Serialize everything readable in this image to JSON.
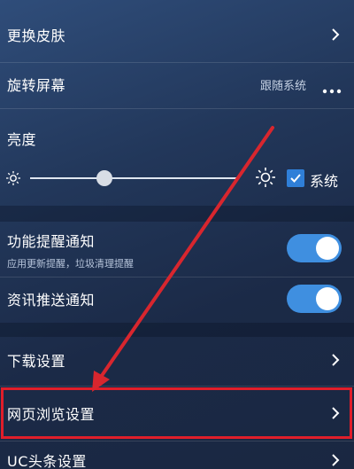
{
  "settings": {
    "skin_label": "更换皮肤",
    "rotate_label": "旋转屏幕",
    "rotate_value": "跟随系统",
    "brightness_label": "亮度",
    "system_label": "系统",
    "brightness_system_checked": true,
    "feature_notify_label": "功能提醒通知",
    "feature_notify_sub": "应用更新提醒，垃圾清理提醒",
    "feature_notify_on": true,
    "news_push_label": "资讯推送通知",
    "news_push_on": true,
    "download_label": "下载设置",
    "web_browse_label": "网页浏览设置",
    "uc_headline_label": "UC头条设置"
  },
  "colors": {
    "accent_blue": "#3f8fe0",
    "highlight_red": "#e01e2a"
  },
  "icons": [
    "chevron-right-icon",
    "more-dots-icon",
    "sun-dim-icon",
    "sun-bright-icon",
    "check-icon"
  ]
}
